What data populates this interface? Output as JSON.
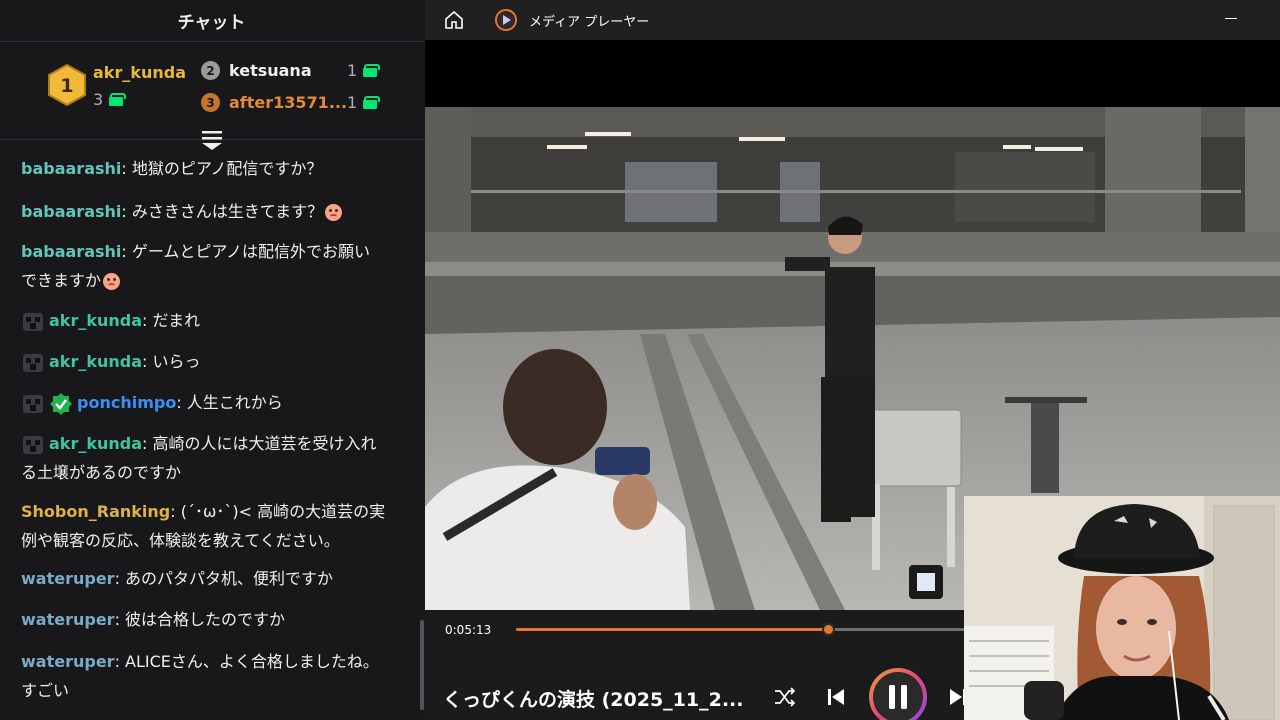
{
  "chat": {
    "title": "チャット",
    "leaderboard": [
      {
        "rank": "1",
        "name": "akr_kunda",
        "count": "3",
        "color": "#e8b83a"
      },
      {
        "rank": "2",
        "name": "ketsuana",
        "count": "1",
        "color": "#c9c9c9"
      },
      {
        "rank": "3",
        "name": "after13571...",
        "count": "1",
        "color": "#d17b2f"
      }
    ],
    "messages": [
      {
        "user": "babaarashi",
        "user_color": "#63c5b7",
        "text": "地獄のピアノ配信ですか？",
        "emoji": false
      },
      {
        "user": "babaarashi",
        "user_color": "#63c5b7",
        "text": "みさきさんは生きてます？",
        "emoji": true
      },
      {
        "user": "babaarashi",
        "user_color": "#63c5b7",
        "text": "ゲームとピアノは配信外でお願い",
        "cont": "できますか",
        "emoji": true
      },
      {
        "user": "akr_kunda",
        "user_color": "#3fc59f",
        "text": "だまれ",
        "emoji": false
      },
      {
        "user": "akr_kunda",
        "user_color": "#3fc59f",
        "text": "いらっ",
        "emoji": false
      },
      {
        "user": "ponchimpo",
        "user_color": "#3a8ff5",
        "text": "人生これから",
        "emoji": false
      },
      {
        "user": "akr_kunda",
        "user_color": "#3fc59f",
        "text": "高崎の人には大道芸を受け入れ",
        "cont": "る土壌があるのですか",
        "emoji": false
      },
      {
        "user": "Shobon_Ranking",
        "user_color": "#e0b04a",
        "text": "(´･ω･`)< 高崎の大道芸の実",
        "cont": "例や観客の反応、体験談を教えてください。",
        "emoji": false
      },
      {
        "user": "wateruper",
        "user_color": "#7aa9c9",
        "text": "あのパタパタ机、便利ですか",
        "emoji": false
      },
      {
        "user": "wateruper",
        "user_color": "#7aa9c9",
        "text": "彼は合格したのですか",
        "emoji": false
      },
      {
        "user": "wateruper",
        "user_color": "#7aa9c9",
        "text": "ALICEさん、よく合格しましたね。",
        "cont": "すごい",
        "emoji": false
      }
    ]
  },
  "player": {
    "app_title": "メディア プレーヤー",
    "current_time": "0:05:13",
    "progress": 0.41,
    "media_title": "くっぴくんの演技 (2025_11_2...",
    "accent_color": "#e8762f",
    "icons": {
      "home": "home-icon",
      "app": "media-player-icon",
      "minimize": "minimize-icon",
      "shuffle": "shuffle-icon",
      "previous": "previous-icon",
      "pause": "pause-icon",
      "next": "next-icon"
    }
  }
}
